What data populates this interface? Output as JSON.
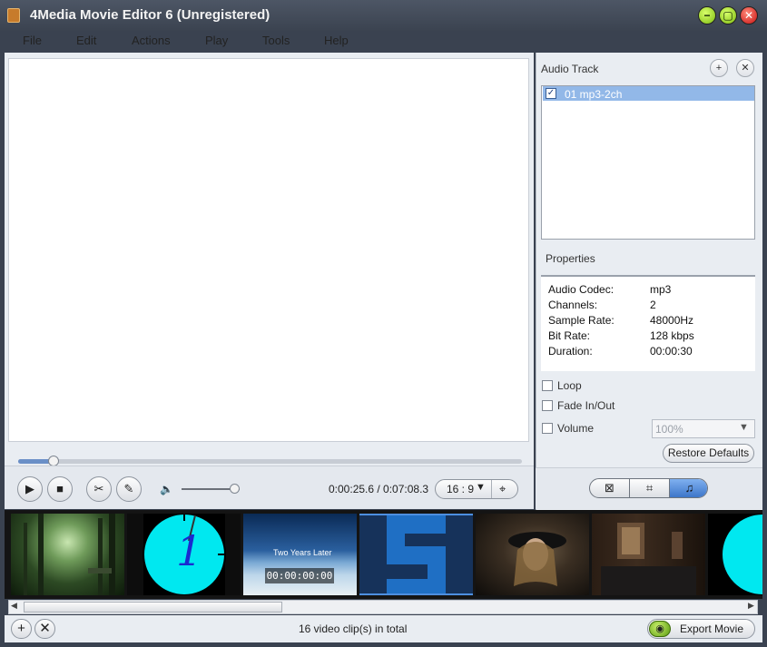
{
  "window": {
    "title": "4Media Movie Editor 6 (Unregistered)",
    "minimize_glyph": "−",
    "maximize_glyph": "▢",
    "close_glyph": "✕"
  },
  "menu": {
    "items": [
      {
        "label": "File"
      },
      {
        "label": "Edit"
      },
      {
        "label": "Actions"
      },
      {
        "label": "Play"
      },
      {
        "label": "Tools"
      },
      {
        "label": "Help"
      }
    ]
  },
  "player": {
    "progress": 0.07,
    "time_display": "0:00:25.6 / 0:07:08.3",
    "aspect_ratio": "16 : 9",
    "volume_level": 0.9,
    "play_glyph": "▶",
    "stop_glyph": "■",
    "cut_glyph": "✂",
    "edit_glyph": "✎",
    "volume_glyph": "🔈",
    "aspect_arrow": "▼",
    "fit_glyph": "⌖"
  },
  "audio_panel": {
    "title": "Audio Track",
    "add_glyph": "+",
    "remove_glyph": "✕",
    "tracks": [
      {
        "label": "01 mp3-2ch",
        "checked": true,
        "check_glyph": "✓"
      }
    ]
  },
  "properties": {
    "title": "Properties",
    "rows": [
      {
        "label": "Audio Codec:",
        "value": "mp3"
      },
      {
        "label": "Channels:",
        "value": "2"
      },
      {
        "label": "Sample Rate:",
        "value": "48000Hz"
      },
      {
        "label": "Bit Rate:",
        "value": "128 kbps"
      },
      {
        "label": "Duration:",
        "value": "00:00:30"
      }
    ]
  },
  "options": {
    "loop_label": "Loop",
    "fade_label": "Fade In/Out",
    "volume_label": "Volume",
    "volume_value": "100%",
    "volume_arrow": "▼",
    "restore_label": "Restore Defaults"
  },
  "mode_tabs": {
    "video_glyph": "⊠",
    "crop_glyph": "⌗",
    "audio_glyph": "♫"
  },
  "filmstrip": {
    "clip_2_digit": "1",
    "clip_3_caption": "Two Years Later",
    "clip_3_timecode": "00:00:00:00"
  },
  "status": {
    "text": "16 video clip(s) in total",
    "add_glyph": "+",
    "remove_glyph": "✕",
    "export_label": "Export Movie",
    "export_glyph": "◉",
    "scroll_left": "◀",
    "scroll_right": "▶"
  },
  "colors": {
    "accent": "#3d76c9",
    "selection": "#92b8e8",
    "titlebar": "#3a4250"
  }
}
